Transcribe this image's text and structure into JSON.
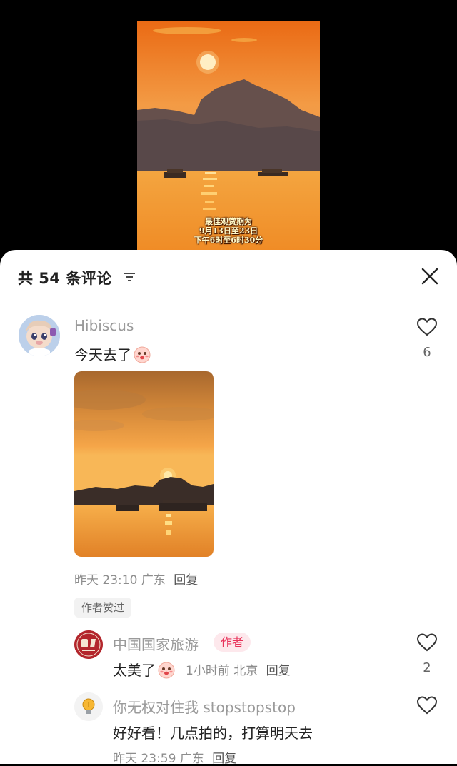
{
  "video": {
    "caption_line1": "最佳观赏期为",
    "caption_line2": "9月13日至23日",
    "caption_line3": "下午6时至6时30分"
  },
  "header": {
    "comment_count_text": "共 54 条评论",
    "filter_icon": "filter-icon",
    "close_icon": "close-icon"
  },
  "comments": [
    {
      "username": "Hibiscus",
      "text": "今天去了",
      "emoji": "blushing-face-emoji",
      "like_count": "6",
      "meta_time": "昨天 23:10",
      "meta_location": "广东",
      "reply_label": "回复",
      "author_liked_label": "作者赞过"
    },
    {
      "username": "中国国家旅游",
      "author_tag": "作者",
      "text": "太美了",
      "emoji": "blushing-face-emoji",
      "meta_time": "1小时前",
      "meta_location": "北京",
      "reply_label": "回复",
      "like_count": "2"
    },
    {
      "username": "你无权对住我 stopstopstop",
      "text": "好好看！几点拍的，打算明天去",
      "meta_time": "昨天 23:59",
      "meta_location": "广东",
      "reply_label": "回复"
    }
  ],
  "colors": {
    "author_tag_bg": "#fde8ec",
    "author_tag_text": "#e8335a",
    "sunset_orange": "#f08a2e"
  }
}
